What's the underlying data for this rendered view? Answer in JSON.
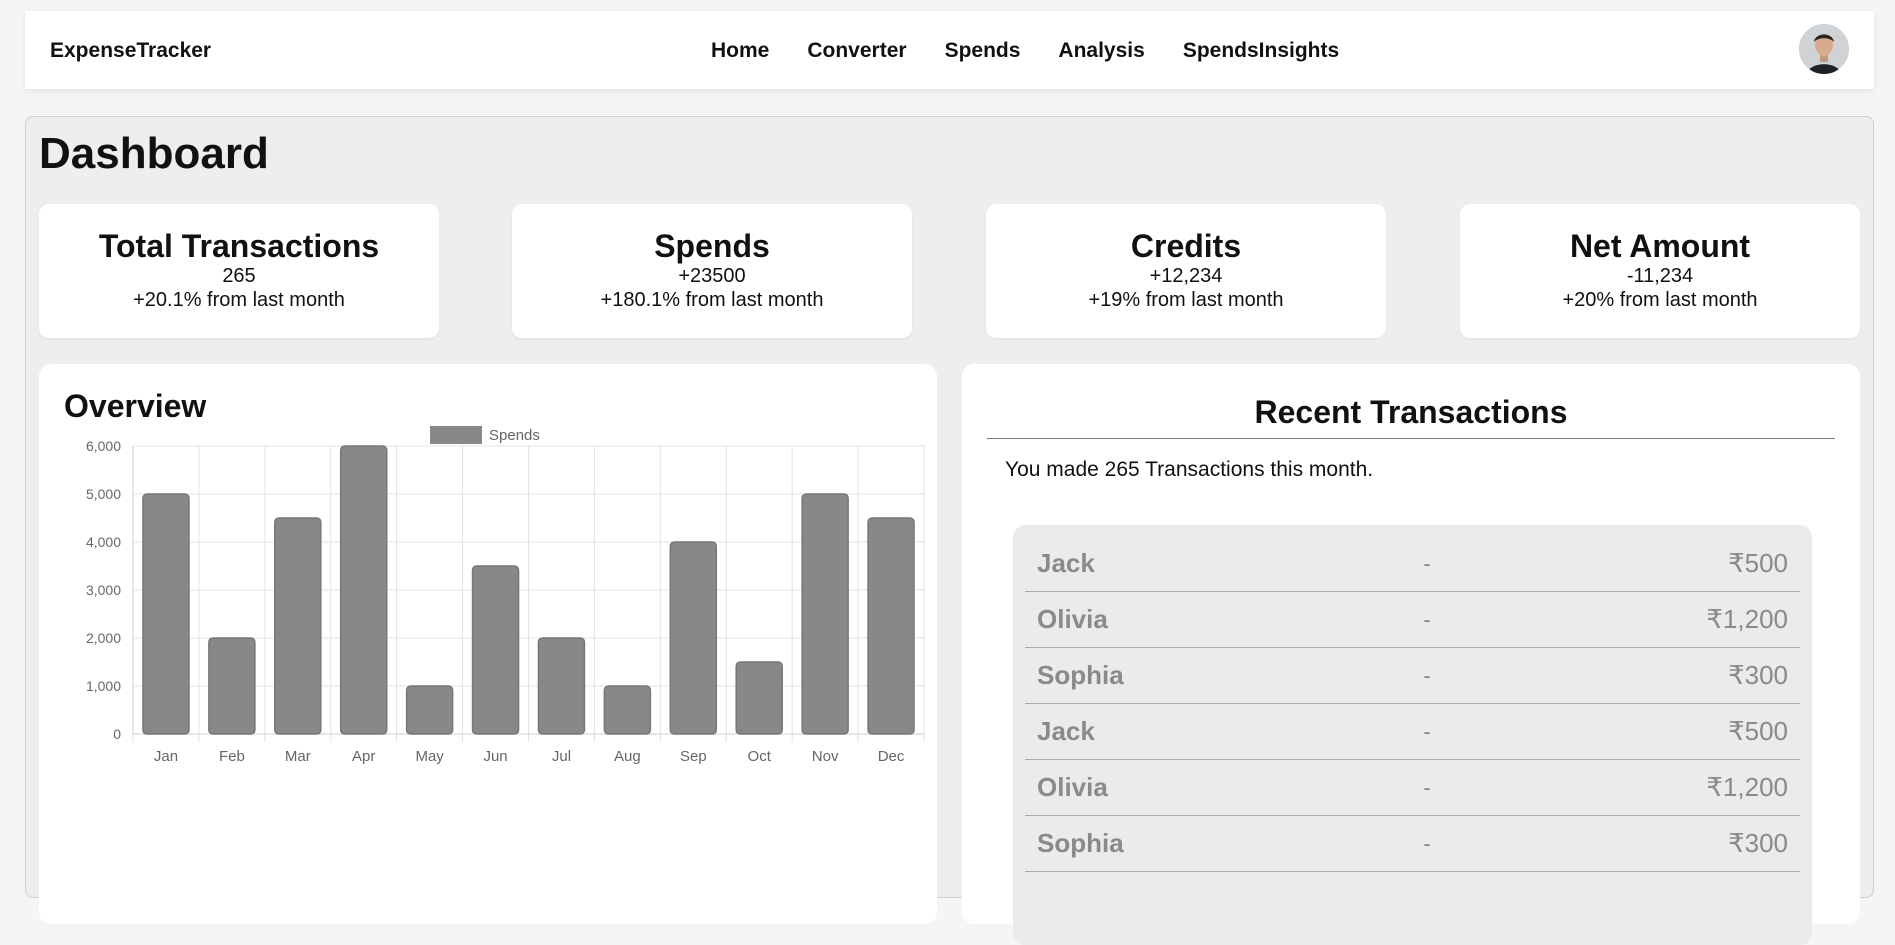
{
  "app": {
    "brand": "ExpenseTracker"
  },
  "nav": {
    "items": [
      "Home",
      "Converter",
      "Spends",
      "Analysis",
      "SpendsInsights"
    ]
  },
  "page": {
    "title": "Dashboard"
  },
  "cards": [
    {
      "title": "Total Transactions",
      "value": "265",
      "delta": "+20.1% from last month"
    },
    {
      "title": "Spends",
      "value": "+23500",
      "delta": "+180.1% from last month"
    },
    {
      "title": "Credits",
      "value": "+12,234",
      "delta": "+19% from last month"
    },
    {
      "title": "Net Amount",
      "value": "-11,234",
      "delta": "+20% from last month"
    }
  ],
  "overview": {
    "title": "Overview"
  },
  "chart_data": {
    "type": "bar",
    "categories": [
      "Jan",
      "Feb",
      "Mar",
      "Apr",
      "May",
      "Jun",
      "Jul",
      "Aug",
      "Sep",
      "Oct",
      "Nov",
      "Dec"
    ],
    "series": [
      {
        "name": "Spends",
        "values": [
          5000,
          2000,
          4500,
          6000,
          1000,
          3500,
          2000,
          1000,
          4000,
          1500,
          5000,
          4500
        ]
      }
    ],
    "yticks": [
      "0",
      "1,000",
      "2,000",
      "3,000",
      "4,000",
      "5,000",
      "6,000"
    ],
    "ylim": [
      0,
      6000
    ],
    "legend": "top-center",
    "grid": true,
    "bar_color": "#888888"
  },
  "recent": {
    "title": "Recent Transactions",
    "subtitle": "You made 265 Transactions this month.",
    "rows": [
      {
        "name": "Jack",
        "sep": "-",
        "amount": "₹500"
      },
      {
        "name": "Olivia",
        "sep": "-",
        "amount": "₹1,200"
      },
      {
        "name": "Sophia",
        "sep": "-",
        "amount": "₹300"
      },
      {
        "name": "Jack",
        "sep": "-",
        "amount": "₹500"
      },
      {
        "name": "Olivia",
        "sep": "-",
        "amount": "₹1,200"
      },
      {
        "name": "Sophia",
        "sep": "-",
        "amount": "₹300"
      }
    ]
  }
}
